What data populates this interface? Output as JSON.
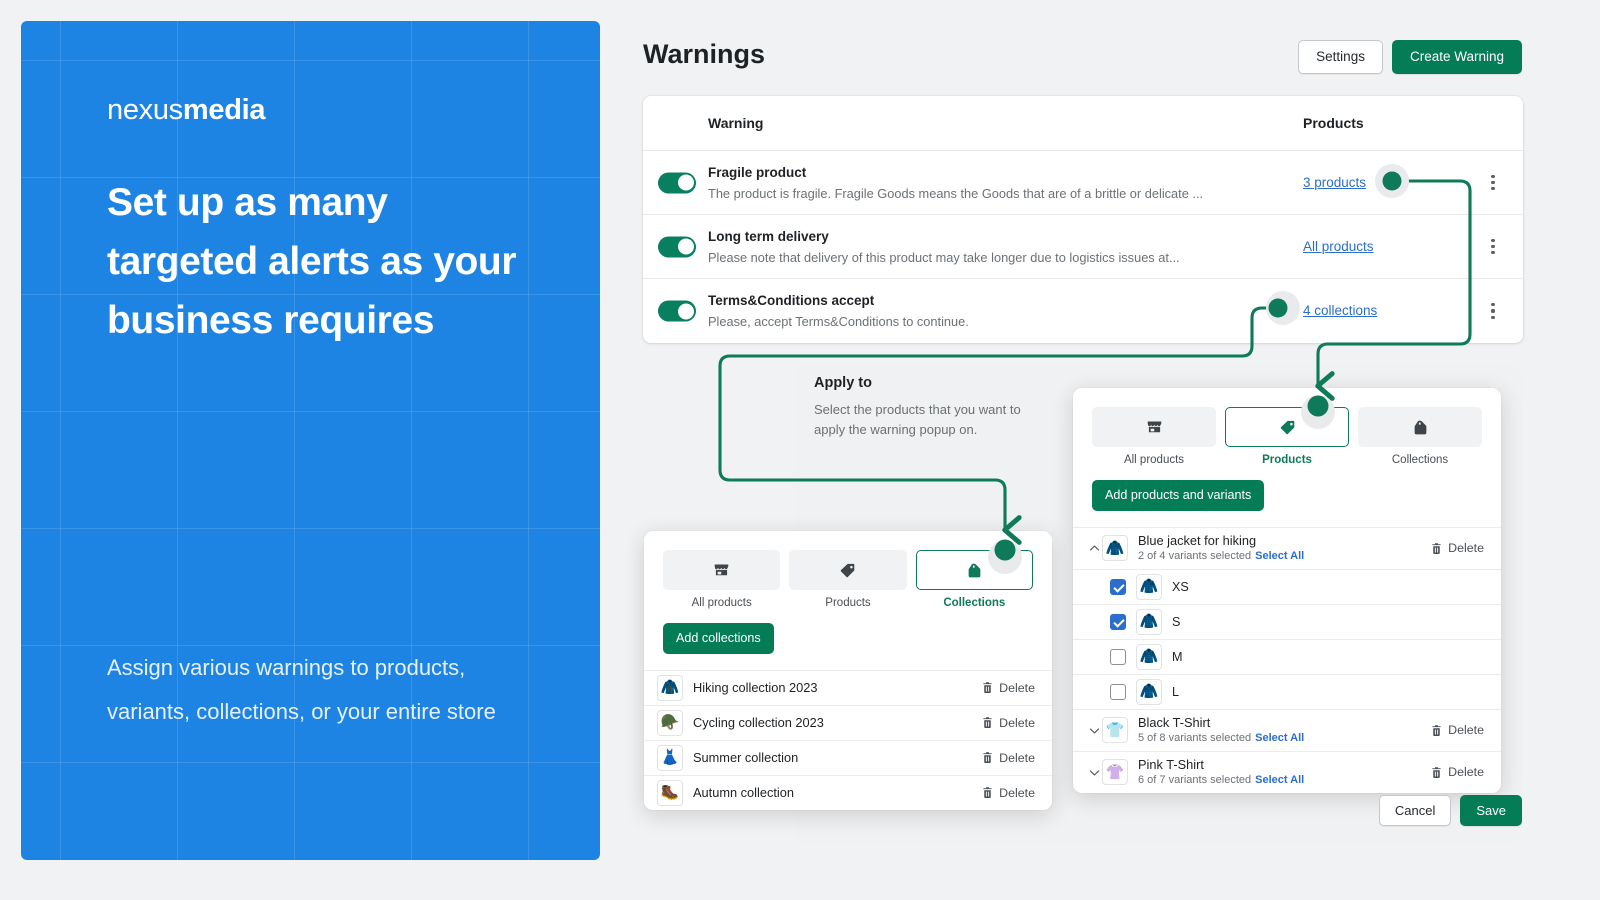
{
  "promo": {
    "logo_light": "nexus",
    "logo_bold": "media",
    "headline": "Set up as many targeted alerts as your business requires",
    "subtext": "Assign various warnings to products, variants, collections, or your entire store",
    "bg_color": "#1e84e4"
  },
  "header": {
    "title": "Warnings",
    "settings_label": "Settings",
    "create_label": "Create Warning"
  },
  "warnings_table": {
    "columns": {
      "warning": "Warning",
      "products": "Products"
    },
    "rows": [
      {
        "name": "Fragile product",
        "description": "The product is fragile. Fragile Goods means the Goods that are of a brittle or delicate ...",
        "link": "3 products",
        "enabled": true
      },
      {
        "name": "Long term delivery",
        "description": "Please note that delivery of this product may take longer due to logistics issues at...",
        "link": "All products",
        "enabled": true
      },
      {
        "name": "Terms&Conditions accept",
        "description": "Please, accept Terms&Conditions to continue.",
        "link": "4 collections",
        "enabled": true
      }
    ]
  },
  "apply_to": {
    "title": "Apply to",
    "description": "Select the products that you want to apply the warning popup on."
  },
  "products_modal": {
    "tabs": [
      {
        "label": "All products",
        "icon": "storefront-icon",
        "active": false
      },
      {
        "label": "Products",
        "icon": "tag-icon",
        "active": true
      },
      {
        "label": "Collections",
        "icon": "bag-icon",
        "active": false
      }
    ],
    "add_button": "Add products and variants",
    "delete_label": "Delete",
    "select_all_label": "Select All",
    "items": [
      {
        "name": "Blue jacket for hiking",
        "meta": "2 of 4 variants selected",
        "expanded": true,
        "thumb": "blue-jacket",
        "variants": [
          {
            "label": "XS",
            "checked": true,
            "thumb": "blue-jacket"
          },
          {
            "label": "S",
            "checked": true,
            "thumb": "blue-jacket"
          },
          {
            "label": "M",
            "checked": false,
            "thumb": "blue-jacket"
          },
          {
            "label": "L",
            "checked": false,
            "thumb": "blue-jacket"
          }
        ]
      },
      {
        "name": "Black T-Shirt",
        "meta": "5 of 8 variants selected",
        "expanded": false,
        "thumb": "black-tshirt",
        "variants": []
      },
      {
        "name": "Pink T-Shirt",
        "meta": "6 of 7 variants selected",
        "expanded": false,
        "thumb": "pink-tshirt",
        "variants": []
      }
    ],
    "cancel_label": "Cancel",
    "save_label": "Save"
  },
  "collections_modal": {
    "tabs": [
      {
        "label": "All products",
        "icon": "storefront-icon",
        "active": false
      },
      {
        "label": "Products",
        "icon": "tag-icon",
        "active": false
      },
      {
        "label": "Collections",
        "icon": "bag-icon",
        "active": true
      }
    ],
    "add_button": "Add collections",
    "delete_label": "Delete",
    "items": [
      {
        "name": "Hiking collection 2023",
        "thumb": "blue-jacket"
      },
      {
        "name": "Cycling collection 2023",
        "thumb": "helmet"
      },
      {
        "name": "Summer collection",
        "thumb": "blue-dress"
      },
      {
        "name": "Autumn collection",
        "thumb": "green-boots"
      }
    ]
  },
  "colors": {
    "brand_green": "#047c56",
    "connector_green": "#0f7a59",
    "link_blue": "#2c6ecb",
    "promo_blue": "#1e84e4",
    "checkbox_blue": "#2c6ecb"
  }
}
